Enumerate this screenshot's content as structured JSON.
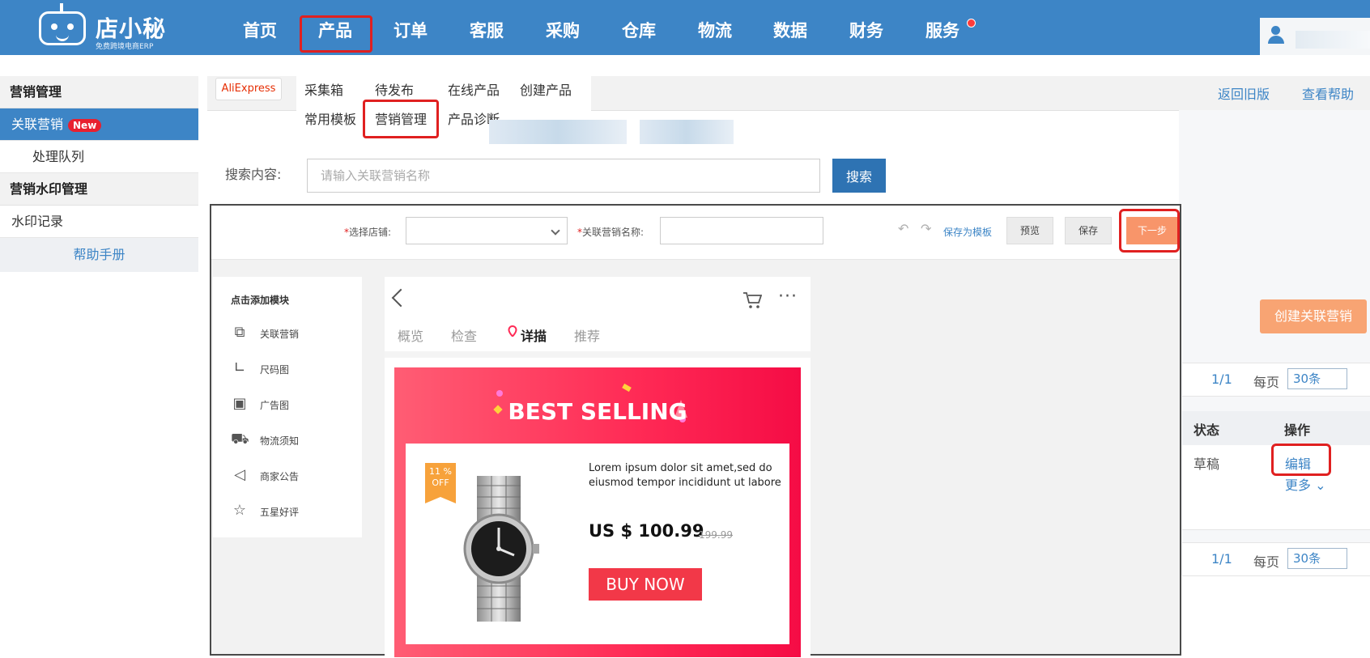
{
  "logo": {
    "name": "店小秘",
    "subtitle": "免费跨境电商ERP"
  },
  "nav": {
    "items": [
      "首页",
      "产品",
      "订单",
      "客服",
      "采购",
      "仓库",
      "物流",
      "数据",
      "财务",
      "服务"
    ],
    "active": "产品"
  },
  "sidebar": {
    "section1": "营销管理",
    "item_active": "关联营销",
    "badge": "New",
    "item_sub": "处理队列",
    "section2": "营销水印管理",
    "item_watermark": "水印记录",
    "help": "帮助手册"
  },
  "platform": "AliExpress",
  "submenu": {
    "row1": [
      "采集箱",
      "待发布",
      "在线产品",
      "创建产品"
    ],
    "row2": [
      "常用模板",
      "营销管理",
      "产品诊断"
    ],
    "active": "营销管理"
  },
  "top_links": {
    "old_version": "返回旧版",
    "help": "查看帮助"
  },
  "search": {
    "label": "搜索内容:",
    "placeholder": "请输入关联营销名称",
    "button": "搜索"
  },
  "create_button": "创建关联营销",
  "pagination": {
    "page": "1/1",
    "per_page_label": "每页",
    "per_page_value": "30条"
  },
  "table": {
    "headers": {
      "status": "状态",
      "actions": "操作"
    },
    "row": {
      "status": "草稿",
      "edit": "编辑",
      "more": "更多"
    }
  },
  "editor": {
    "toolbar": {
      "store_label": "选择店铺:",
      "name_label": "关联营销名称:",
      "save_template": "保存为模板",
      "preview": "预览",
      "save": "保存",
      "next": "下一步"
    },
    "modules": {
      "title": "点击添加模块",
      "items": [
        {
          "icon": "related-icon",
          "label": "关联营销"
        },
        {
          "icon": "ruler-icon",
          "label": "尺码图"
        },
        {
          "icon": "image-icon",
          "label": "广告图"
        },
        {
          "icon": "truck-icon",
          "label": "物流须知"
        },
        {
          "icon": "megaphone-icon",
          "label": "商家公告"
        },
        {
          "icon": "star-icon",
          "label": "五星好评"
        }
      ]
    },
    "phone": {
      "tabs": [
        "概览",
        "检查",
        "详描",
        "推荐"
      ],
      "active_tab": "详描",
      "banner_title": "BEST SELLING",
      "off_tag": "11 % OFF",
      "description": "Lorem ipsum dolor sit amet,sed do eiusmod tempor incididunt ut labore",
      "price": "US $ 100.99",
      "old_price": "199.99",
      "buy": "BUY NOW"
    }
  },
  "colors": {
    "primary": "#3d85c6",
    "highlight_border": "#e02020",
    "next_button": "#f8956a",
    "banner": "#ff2a55",
    "buy_button": "#f23848"
  }
}
